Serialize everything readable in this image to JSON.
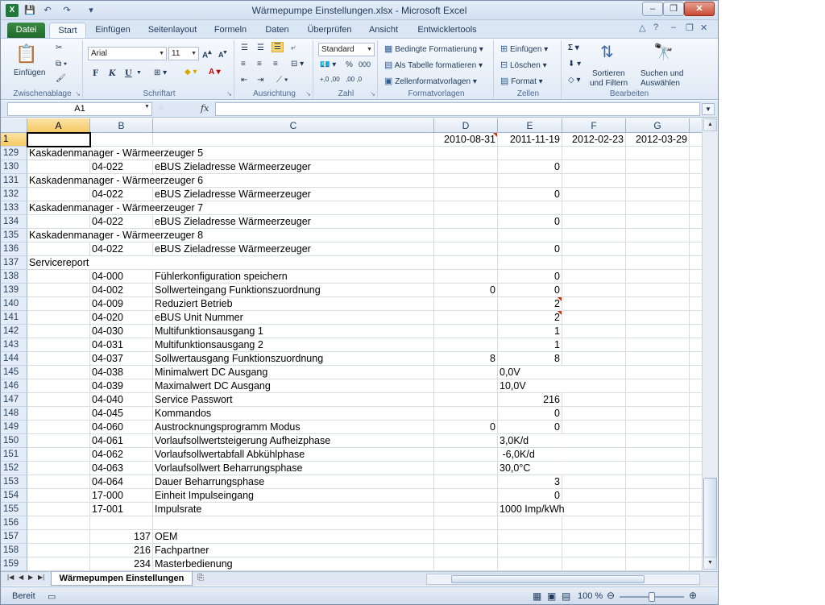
{
  "window": {
    "title": "Wärmepumpe Einstellungen.xlsx - Microsoft Excel",
    "app_icon": "X",
    "controls": {
      "minimize": "–",
      "restore": "❐",
      "close": "✕"
    }
  },
  "quick_access": {
    "save_icon": "save-icon",
    "undo_icon": "undo-icon",
    "redo_icon": "redo-icon"
  },
  "tabs": [
    {
      "label": "Datei"
    },
    {
      "label": "Start"
    },
    {
      "label": "Einfügen"
    },
    {
      "label": "Seitenlayout"
    },
    {
      "label": "Formeln"
    },
    {
      "label": "Daten"
    },
    {
      "label": "Überprüfen"
    },
    {
      "label": "Ansicht"
    },
    {
      "label": "Entwicklertools"
    }
  ],
  "ribbon": {
    "groups": {
      "clipboard": "Zwischenablage",
      "font": "Schriftart",
      "alignment": "Ausrichtung",
      "number": "Zahl",
      "styles": "Formatvorlagen",
      "cells": "Zellen",
      "editing": "Bearbeiten"
    },
    "paste_label": "Einfügen",
    "font_name": "Arial",
    "font_size": "11",
    "bold": "F",
    "italic": "K",
    "underline": "U",
    "number_format": "Standard",
    "conditional_formatting": "Bedingte Formatierung",
    "format_as_table": "Als Tabelle formatieren",
    "cell_styles": "Zellenformatvorlagen",
    "insert": "Einfügen",
    "delete": "Löschen",
    "format": "Format",
    "sort_filter_1": "Sortieren",
    "sort_filter_2": "und Filtern",
    "find_select_1": "Suchen und",
    "find_select_2": "Auswählen",
    "percent": "%",
    "thousands": "000",
    "dec_inc": "+,0 ,00",
    "dec_dec": ",00 ,0"
  },
  "formula_bar": {
    "name_box": "A1",
    "fx": "fx",
    "formula": ""
  },
  "columns": [
    "A",
    "B",
    "C",
    "D",
    "E",
    "F",
    "G"
  ],
  "header_row": {
    "row": "1",
    "D": "2010-08-31",
    "E": "2011-11-19",
    "F": "2012-02-23",
    "G": "2012-03-29"
  },
  "rows": [
    {
      "row": "129",
      "A": "Kaskadenmanager - Wärmeerzeuger 5"
    },
    {
      "row": "130",
      "B": "04-022",
      "C": "eBUS Zieladresse Wärmeerzeuger",
      "E": "0"
    },
    {
      "row": "131",
      "A": "Kaskadenmanager - Wärmeerzeuger 6"
    },
    {
      "row": "132",
      "B": "04-022",
      "C": "eBUS Zieladresse Wärmeerzeuger",
      "E": "0"
    },
    {
      "row": "133",
      "A": "Kaskadenmanager - Wärmeerzeuger 7"
    },
    {
      "row": "134",
      "B": "04-022",
      "C": "eBUS Zieladresse Wärmeerzeuger",
      "E": "0"
    },
    {
      "row": "135",
      "A": "Kaskadenmanager - Wärmeerzeuger 8"
    },
    {
      "row": "136",
      "B": "04-022",
      "C": "eBUS Zieladresse Wärmeerzeuger",
      "E": "0"
    },
    {
      "row": "137",
      "A": "Servicereport"
    },
    {
      "row": "138",
      "B": "04-000",
      "C": "Fühlerkonfiguration speichern",
      "E": "0"
    },
    {
      "row": "139",
      "B": "04-002",
      "C": "Sollwerteingang Funktionszuordnung",
      "D": "0",
      "E": "0"
    },
    {
      "row": "140",
      "B": "04-009",
      "C": "Reduziert Betrieb",
      "E": "2"
    },
    {
      "row": "141",
      "B": "04-020",
      "C": "eBUS Unit Nummer",
      "E": "2"
    },
    {
      "row": "142",
      "B": "04-030",
      "C": "Multifunktionsausgang 1",
      "E": "1"
    },
    {
      "row": "143",
      "B": "04-031",
      "C": "Multifunktionsausgang 2",
      "E": "1"
    },
    {
      "row": "144",
      "B": "04-037",
      "C": "Sollwertausgang Funktionszuordnung",
      "D": "8",
      "E": "8"
    },
    {
      "row": "145",
      "B": "04-038",
      "C": "Minimalwert DC Ausgang",
      "E_left": "0,0V"
    },
    {
      "row": "146",
      "B": "04-039",
      "C": "Maximalwert DC Ausgang",
      "E_left": "10,0V"
    },
    {
      "row": "147",
      "B": "04-040",
      "C": "Service Passwort",
      "E": "216"
    },
    {
      "row": "148",
      "B": "04-045",
      "C": "Kommandos",
      "E": "0"
    },
    {
      "row": "149",
      "B": "04-060",
      "C": "Austrocknungsprogramm Modus",
      "D": "0",
      "E": "0"
    },
    {
      "row": "150",
      "B": "04-061",
      "C": "Vorlaufsollwertsteigerung Aufheizphase",
      "E_left": "3,0K/d"
    },
    {
      "row": "151",
      "B": "04-062",
      "C": "Vorlaufsollwertabfall Abkühlphase",
      "E_left": " -6,0K/d"
    },
    {
      "row": "152",
      "B": "04-063",
      "C": "Vorlaufsollwert Beharrungsphase",
      "E_left": "30,0°C"
    },
    {
      "row": "153",
      "B": "04-064",
      "C": "Dauer Beharrungsphase",
      "E": "3"
    },
    {
      "row": "154",
      "B": "17-000",
      "C": "Einheit Impulseingang",
      "E": "0"
    },
    {
      "row": "155",
      "B": "17-001",
      "C": "Impulsrate",
      "E_left": "1000 Imp/kWh"
    },
    {
      "row": "156"
    },
    {
      "row": "157",
      "B": "137",
      "C": "OEM"
    },
    {
      "row": "158",
      "B": "216",
      "C": "Fachpartner"
    },
    {
      "row": "159",
      "B": "234",
      "C": "Masterbedienung"
    }
  ],
  "sheet_tabs": [
    {
      "label": "Wärmepumpen Einstellungen"
    }
  ],
  "status": {
    "ready": "Bereit",
    "zoom": "100 %"
  }
}
